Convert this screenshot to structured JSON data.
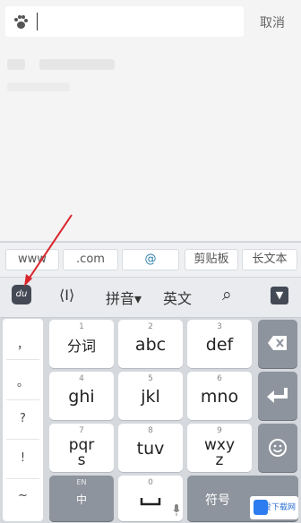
{
  "search": {
    "placeholder": "",
    "cancel_label": "取消"
  },
  "candidate_bar": {
    "chips": [
      "www",
      ".com",
      "@",
      "剪贴板",
      "长文本"
    ]
  },
  "toolbar": {
    "logo_label": "du",
    "cursor_glyph": "⟨I⟩",
    "pinyin_label": "拼音▾",
    "english_label": "英文",
    "search_glyph": "⌕",
    "hide_glyph": "▼"
  },
  "punctuation": [
    "，",
    "。",
    "?",
    "!",
    "~"
  ],
  "keys": [
    {
      "num": "1",
      "label": "分词"
    },
    {
      "num": "2",
      "label": "abc"
    },
    {
      "num": "3",
      "label": "def"
    },
    {
      "num": "4",
      "label": "ghi"
    },
    {
      "num": "5",
      "label": "jkl"
    },
    {
      "num": "6",
      "label": "mno"
    },
    {
      "num": "7",
      "label": "pqr\ns"
    },
    {
      "num": "8",
      "label": "tuv"
    },
    {
      "num": "9",
      "label": "wxy\nz"
    }
  ],
  "bottom_row": {
    "lang_top": "EN",
    "lang_main": "中",
    "space_num": "0",
    "symbol_label": "符号"
  },
  "side_keys": {
    "backspace_icon": "backspace-icon",
    "enter_icon": "enter-icon",
    "emoji_icon": "emoji-icon"
  },
  "annotation": {
    "arrow_color": "#d9242a"
  },
  "watermark": {
    "text": "吾爱下载网"
  }
}
